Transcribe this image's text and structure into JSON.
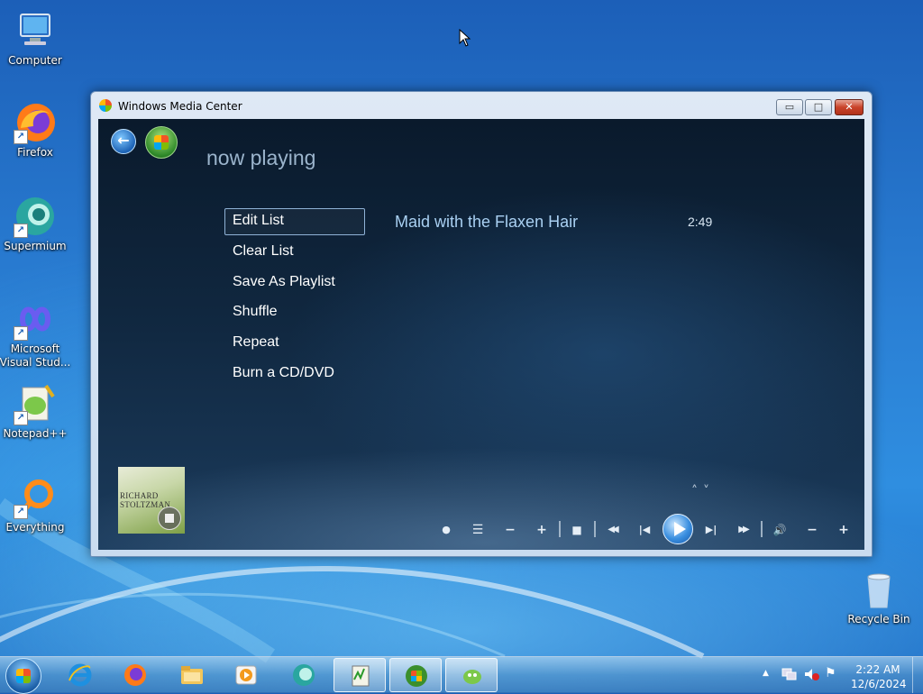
{
  "desktop": {
    "icons": [
      {
        "label": "Computer"
      },
      {
        "label": "Firefox"
      },
      {
        "label": "Supermium"
      },
      {
        "label": "Microsoft Visual Stud..."
      },
      {
        "label": "Notepad++"
      },
      {
        "label": "Everything"
      },
      {
        "label": "Recycle Bin"
      }
    ]
  },
  "window": {
    "title": "Windows Media Center",
    "controls": {
      "minimize": "▭",
      "maximize": "□",
      "close": "✕"
    }
  },
  "media_center": {
    "page_title": "now playing",
    "menu": [
      {
        "label": "Edit List",
        "focused": true
      },
      {
        "label": "Clear List"
      },
      {
        "label": "Save As Playlist"
      },
      {
        "label": "Shuffle"
      },
      {
        "label": "Repeat"
      },
      {
        "label": "Burn a CD/DVD"
      }
    ],
    "track": {
      "title": "Maid with the Flaxen Hair",
      "duration": "2:49"
    },
    "album_art": {
      "text_line1": "RICHARD",
      "text_line2": "STOLTZMAN"
    },
    "transport": {
      "record": "●",
      "playlist": "☰",
      "ch_minus": "−",
      "ch_plus": "+",
      "stop": "■",
      "rewind": "◀◀",
      "prev": "|◀",
      "play": "play",
      "next": "▶|",
      "fast_forward": "▶▶",
      "mute": "🔊",
      "vol_minus": "−",
      "vol_plus": "+"
    },
    "scroll": {
      "up": "˄",
      "down": "˅"
    }
  },
  "taskbar": {
    "clock_time": "2:22 AM",
    "clock_date": "12/6/2024",
    "tray_arrow": "▲",
    "tray_flag": "⚑"
  },
  "icons": [
    "computer-icon",
    "firefox-icon",
    "supermium-icon",
    "visual-studio-icon",
    "notepadpp-icon",
    "everything-icon",
    "recycle-bin-icon"
  ]
}
